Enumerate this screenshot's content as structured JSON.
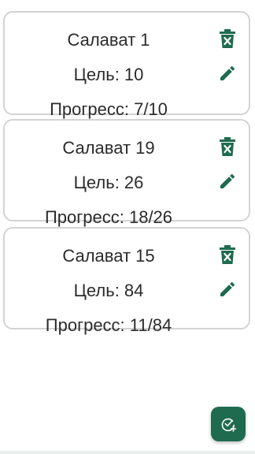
{
  "colors": {
    "accent": "#1f6b50",
    "card_border": "#d3d3d3",
    "text": "#2b2b2b"
  },
  "cards": [
    {
      "title": "Салават 1",
      "goal": "Цель: 10",
      "progress": "Прогресс: 7/10",
      "delete_icon": "trash-icon",
      "edit_icon": "pencil-icon"
    },
    {
      "title": "Салават 19",
      "goal": "Цель: 26",
      "progress": "Прогресс: 18/26",
      "delete_icon": "trash-icon",
      "edit_icon": "pencil-icon"
    },
    {
      "title": "Салават 15",
      "goal": "Цель: 84",
      "progress": "Прогресс: 11/84",
      "delete_icon": "trash-icon",
      "edit_icon": "pencil-icon"
    }
  ],
  "fab": {
    "icon": "add-task-icon"
  }
}
